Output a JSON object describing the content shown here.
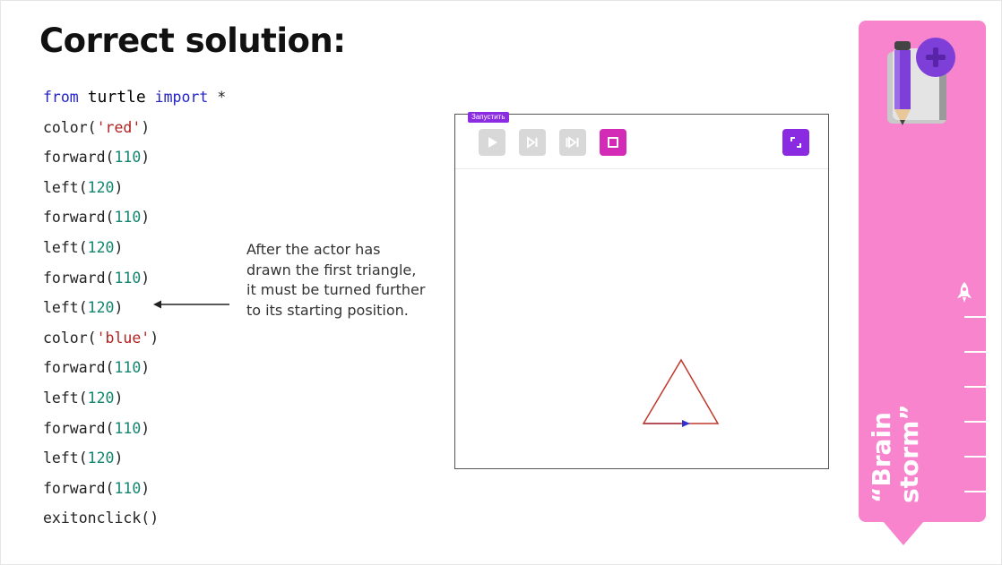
{
  "slide": {
    "title": "Correct solution:"
  },
  "code": {
    "line1": {
      "kw1": "from",
      "module": "turtle",
      "kw2": "import",
      "rest": "*"
    },
    "lines": [
      {
        "fn": "color(",
        "arg": "'red'",
        "close": ")",
        "argType": "str"
      },
      {
        "fn": "forward(",
        "arg": "110",
        "close": ")",
        "argType": "num"
      },
      {
        "fn": "left(",
        "arg": "120",
        "close": ")",
        "argType": "num"
      },
      {
        "fn": "forward(",
        "arg": "110",
        "close": ")",
        "argType": "num"
      },
      {
        "fn": "left(",
        "arg": "120",
        "close": ")",
        "argType": "num"
      },
      {
        "fn": "forward(",
        "arg": "110",
        "close": ")",
        "argType": "num"
      },
      {
        "fn": "left(",
        "arg": "120",
        "close": ")",
        "argType": "num"
      },
      {
        "fn": "color(",
        "arg": "'blue'",
        "close": ")",
        "argType": "str"
      },
      {
        "fn": "forward(",
        "arg": "110",
        "close": ")",
        "argType": "num"
      },
      {
        "fn": "left(",
        "arg": "120",
        "close": ")",
        "argType": "num"
      },
      {
        "fn": "forward(",
        "arg": "110",
        "close": ")",
        "argType": "num"
      },
      {
        "fn": "left(",
        "arg": "120",
        "close": ")",
        "argType": "num"
      },
      {
        "fn": "forward(",
        "arg": "110",
        "close": ")",
        "argType": "num"
      },
      {
        "fn": "exitonclick()",
        "arg": "",
        "close": "",
        "argType": "none"
      }
    ]
  },
  "annotation": {
    "text": "After the actor has drawn the first triangle, it must be turned further to its starting position."
  },
  "turtle_window": {
    "run_label": "Запустить",
    "buttons": [
      {
        "icon": "play-icon",
        "enabled": false
      },
      {
        "icon": "step-icon",
        "enabled": false
      },
      {
        "icon": "step-end-icon",
        "enabled": false
      },
      {
        "icon": "stop-icon",
        "enabled": true,
        "color": "#d42bb6"
      },
      {
        "icon": "fullscreen-icon",
        "enabled": true,
        "color": "#8a2be2"
      }
    ],
    "drawing": {
      "side": 110,
      "turn": 120,
      "first_color": "red",
      "second_color": "blue"
    }
  },
  "sidebar": {
    "label_line1": "“Brain",
    "label_line2": "storm”",
    "color": "#f884ce",
    "icons": [
      "book-pencil-plus-icon",
      "rocket-icon"
    ]
  }
}
